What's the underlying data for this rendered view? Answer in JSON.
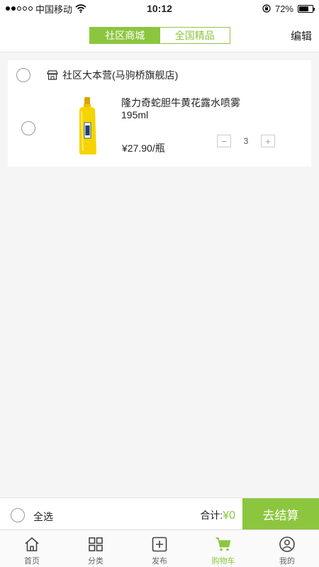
{
  "status_bar": {
    "carrier": "中国移动",
    "time": "10:12",
    "battery": "72%",
    "battery_level": 0.72
  },
  "header": {
    "tabs": [
      {
        "label": "社区商城",
        "active": true
      },
      {
        "label": "全国精品",
        "active": false
      }
    ],
    "edit_label": "编辑"
  },
  "store": {
    "name": "社区大本营(马驹桥旗舰店)",
    "icon": "store-icon",
    "items": [
      {
        "title": "隆力奇蛇胆牛黄花露水喷雾195ml",
        "price": "¥27.90/瓶",
        "quantity": "3",
        "minus": "−",
        "plus": "+"
      }
    ]
  },
  "checkout": {
    "select_all_label": "全选",
    "total_label": "合计:",
    "total_amount": "¥0",
    "checkout_label": "去结算"
  },
  "tab_bar": {
    "items": [
      {
        "label": "首页",
        "icon": "home-icon"
      },
      {
        "label": "分类",
        "icon": "grid-icon"
      },
      {
        "label": "发布",
        "icon": "plus-square-icon"
      },
      {
        "label": "购物车",
        "icon": "cart-icon",
        "active": true
      },
      {
        "label": "我的",
        "icon": "user-icon"
      }
    ]
  },
  "colors": {
    "accent": "#8cc63f",
    "background": "#f5f5f5"
  }
}
